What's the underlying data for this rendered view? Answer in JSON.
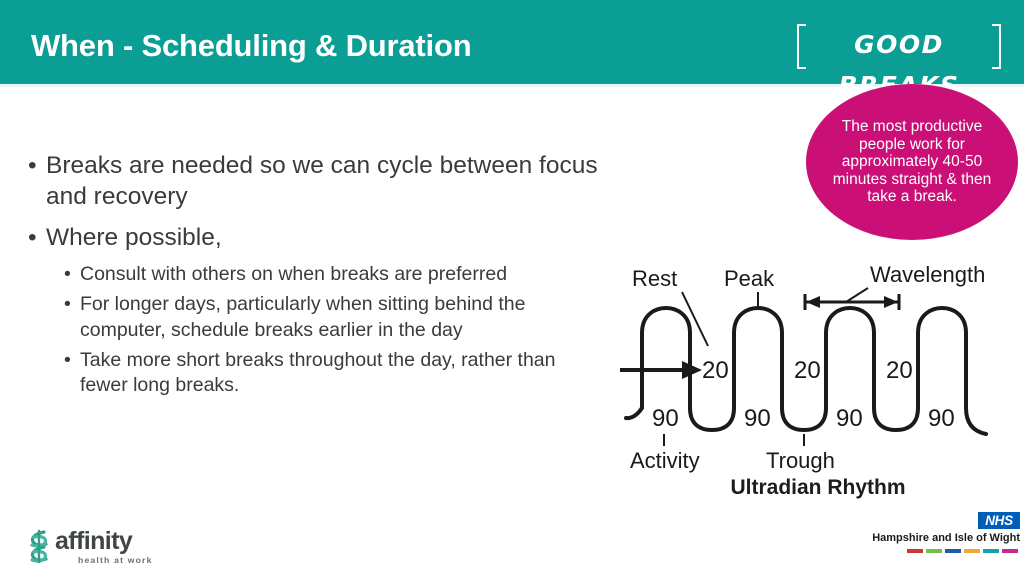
{
  "header": {
    "title": "When - Scheduling & Duration",
    "background_color": "#0b9e95",
    "badge": {
      "label": "GOOD BREAKS"
    }
  },
  "callout": {
    "text": "The most productive people work for approximately 40-50 minutes straight & then take a break.",
    "background_color": "#ca1076",
    "text_color": "#ffffff"
  },
  "body": {
    "bullets": [
      {
        "level": 1,
        "marker": "•",
        "text": "Breaks are needed so we can cycle between focus and recovery"
      },
      {
        "level": 1,
        "marker": "•",
        "text": "Where possible,"
      }
    ],
    "sub_bullets": [
      {
        "level": 2,
        "marker": "•",
        "text": "Consult with others on when breaks are preferred"
      },
      {
        "level": 2,
        "marker": "•",
        "text": "For longer days, particularly when sitting behind the computer, schedule breaks earlier in the day"
      },
      {
        "level": 2,
        "marker": "•",
        "text": "Take more short breaks throughout the day, rather than fewer long breaks."
      }
    ]
  },
  "figure": {
    "caption": "Ultradian Rhythm",
    "labels": {
      "rest": "Rest",
      "peak": "Peak",
      "wavelength": "Wavelength",
      "activity": "Activity",
      "trough": "Trough"
    },
    "peak_values": [
      "90",
      "90",
      "90",
      "90"
    ],
    "trough_values": [
      "20",
      "20",
      "20"
    ]
  },
  "footer": {
    "affinity": {
      "wordmark": "affinity",
      "tagline": "health at work",
      "mark_color": "#2f9e8f"
    },
    "nhs": {
      "brand": "NHS",
      "region": "Hampshire and Isle of Wight",
      "brand_color": "#005eb8",
      "colour_bar": [
        "#c8383c",
        "#72bf44",
        "#1e5aa8",
        "#f0a836",
        "#13a3a8",
        "#c4299a"
      ]
    }
  }
}
